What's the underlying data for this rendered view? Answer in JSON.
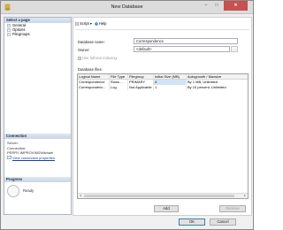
{
  "window": {
    "title": "New Database",
    "minimize": "–",
    "maximize": "□",
    "close": "✕"
  },
  "left": {
    "select_page_header": "Select a page",
    "pages": [
      {
        "label": "General",
        "icon": "page-icon"
      },
      {
        "label": "Options",
        "icon": "page-icon"
      },
      {
        "label": "Filegroups",
        "icon": "page-icon"
      }
    ],
    "connection": {
      "header": "Connection",
      "server_label": "Server:",
      "server_value": "",
      "connection_label": "Connection:",
      "connection_value": "PERRY-IMPROVIND\\Michael",
      "view_properties": "View connection properties"
    },
    "progress": {
      "header": "Progress",
      "status": "Ready"
    }
  },
  "toolbar": {
    "script": "Script",
    "help": "Help"
  },
  "form": {
    "db_name_label": "Database name:",
    "db_name_value": "Correspondence",
    "owner_label": "Owner:",
    "owner_value": "<default>",
    "browse": "...",
    "fulltext_label": "Use full-text indexing",
    "files_label": "Database files:"
  },
  "table": {
    "columns": [
      "Logical Name",
      "File Type",
      "Filegroup",
      "Initial Size (MB)",
      "Autogrowth / Maxsize"
    ],
    "rows": [
      [
        "Correspondence",
        "Rows ...",
        "PRIMARY",
        "4",
        "By 1 MB, Unlimited"
      ],
      [
        "Correspondenc...",
        "Log",
        "Not Applicable",
        "1",
        "By 10 percent, Unlimited"
      ]
    ]
  },
  "buttons": {
    "add": "Add",
    "remove": "Remove",
    "ok": "OK",
    "cancel": "Cancel"
  },
  "colors": {
    "accent": "#1a40a0",
    "close": "#c75050",
    "selection": "#cfe4f8"
  }
}
